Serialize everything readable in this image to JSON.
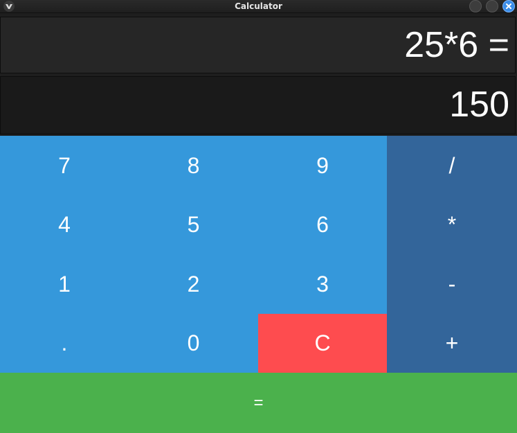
{
  "window": {
    "title": "Calculator"
  },
  "display": {
    "expression": "25*6 =",
    "result": "150"
  },
  "keys": {
    "row1": [
      "7",
      "8",
      "9",
      "/"
    ],
    "row2": [
      "4",
      "5",
      "6",
      "*"
    ],
    "row3": [
      "1",
      "2",
      "3",
      "-"
    ],
    "row4": [
      ".",
      "0",
      "C",
      "+"
    ],
    "equals": "="
  },
  "colors": {
    "number_key": "#3598db",
    "operator_key": "#33659a",
    "clear_key": "#fe4c4f",
    "equals_key": "#4bb14c",
    "display_bg": "#262626"
  },
  "icons": {
    "app": "calculator-app-icon",
    "minimize": "minimize-icon",
    "maximize": "maximize-icon",
    "close": "close-icon"
  }
}
